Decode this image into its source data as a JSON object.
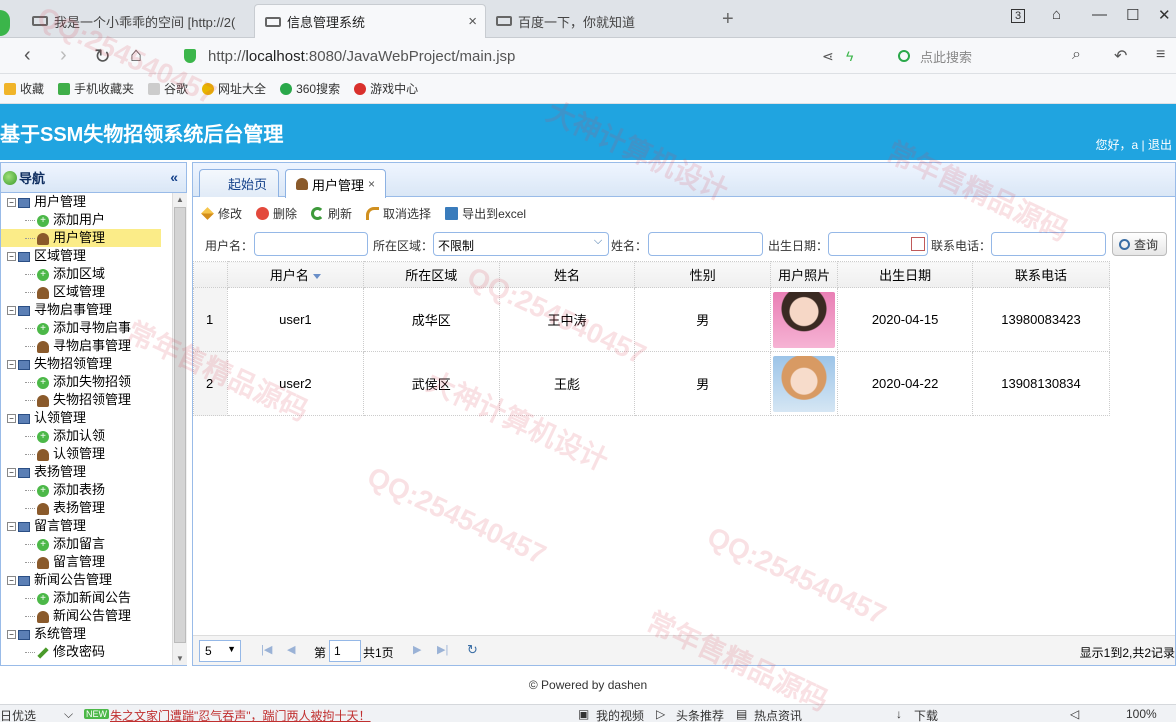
{
  "browser": {
    "tabs": [
      {
        "title": "我是一个小乖乖的空间 [http://2(",
        "active": false
      },
      {
        "title": "信息管理系统",
        "active": true
      },
      {
        "title": "百度一下，你就知道",
        "active": false
      }
    ],
    "tab_close": "×",
    "new_tab": "+",
    "tab_count": "3",
    "url_prefix": "http://",
    "url_host": "localhost",
    "url_path": ":8080/JavaWebProject/main.jsp",
    "search_placeholder": "点此搜索",
    "favorites": [
      {
        "label": "收藏",
        "color": "#f0b429"
      },
      {
        "label": "手机收藏夹",
        "color": "#3fae49"
      },
      {
        "label": "谷歌",
        "color": "#cccccc"
      },
      {
        "label": "网址大全",
        "color": "#e8b400"
      },
      {
        "label": "360搜索",
        "color": "#2aa84a"
      },
      {
        "label": "游戏中心",
        "color": "#d9302c"
      }
    ]
  },
  "app": {
    "title": "基于SSM失物招领系统后台管理",
    "user_greeting": "您好，a | 退出",
    "accent_color": "#20a4e0"
  },
  "nav": {
    "title": "导航",
    "collapse_icon": "«",
    "tree": [
      {
        "type": "parent",
        "label": "用户管理"
      },
      {
        "type": "child",
        "icon": "add",
        "label": "添加用户"
      },
      {
        "type": "child",
        "icon": "user",
        "label": "用户管理",
        "selected": true
      },
      {
        "type": "parent",
        "label": "区域管理"
      },
      {
        "type": "child",
        "icon": "add",
        "label": "添加区域"
      },
      {
        "type": "child",
        "icon": "user",
        "label": "区域管理"
      },
      {
        "type": "parent",
        "label": "寻物启事管理"
      },
      {
        "type": "child",
        "icon": "add",
        "label": "添加寻物启事"
      },
      {
        "type": "child",
        "icon": "user",
        "label": "寻物启事管理"
      },
      {
        "type": "parent",
        "label": "失物招领管理"
      },
      {
        "type": "child",
        "icon": "add",
        "label": "添加失物招领"
      },
      {
        "type": "child",
        "icon": "user",
        "label": "失物招领管理"
      },
      {
        "type": "parent",
        "label": "认领管理"
      },
      {
        "type": "child",
        "icon": "add",
        "label": "添加认领"
      },
      {
        "type": "child",
        "icon": "user",
        "label": "认领管理"
      },
      {
        "type": "parent",
        "label": "表扬管理"
      },
      {
        "type": "child",
        "icon": "add",
        "label": "添加表扬"
      },
      {
        "type": "child",
        "icon": "user",
        "label": "表扬管理"
      },
      {
        "type": "parent",
        "label": "留言管理"
      },
      {
        "type": "child",
        "icon": "add",
        "label": "添加留言"
      },
      {
        "type": "child",
        "icon": "user",
        "label": "留言管理"
      },
      {
        "type": "parent",
        "label": "新闻公告管理"
      },
      {
        "type": "child",
        "icon": "add",
        "label": "添加新闻公告"
      },
      {
        "type": "child",
        "icon": "user",
        "label": "新闻公告管理"
      },
      {
        "type": "parent",
        "label": "系统管理"
      },
      {
        "type": "child",
        "icon": "pen",
        "label": "修改密码"
      }
    ]
  },
  "main": {
    "tabs": [
      {
        "label": "起始页"
      },
      {
        "label": "用户管理",
        "close": "×"
      }
    ],
    "toolbar": {
      "edit": "修改",
      "delete": "删除",
      "refresh": "刷新",
      "cancel_select": "取消选择",
      "export": "导出到excel"
    },
    "search": {
      "username_label": "用户名：",
      "area_label": "所在区域：",
      "area_value": "不限制",
      "name_label": "姓名：",
      "birth_label": "出生日期：",
      "phone_label": "联系电话：",
      "query_button": "查询"
    },
    "grid": {
      "columns": [
        "用户名",
        "所在区域",
        "姓名",
        "性别",
        "用户照片",
        "出生日期",
        "联系电话"
      ],
      "rows": [
        {
          "rownum": "1",
          "username": "user1",
          "area": "成华区",
          "name": "王中涛",
          "gender": "男",
          "photo": "photo-girl-pink",
          "birth": "2020-04-15",
          "phone": "13980083423"
        },
        {
          "rownum": "2",
          "username": "user2",
          "area": "武侯区",
          "name": "王彪",
          "gender": "男",
          "photo": "photo-girl-blue",
          "birth": "2020-04-22",
          "phone": "13908130834"
        }
      ]
    },
    "pager": {
      "page_size": "5",
      "page_label_before": "第",
      "page_number": "1",
      "page_total": "共1页",
      "display_info": "显示1到2,共2记录"
    }
  },
  "footer": "© Powered by dashen",
  "statusbar": {
    "left": "日优选",
    "new_badge": "NEW",
    "news": "朱之文家门遭踹\"忍气吞声\"，踹门两人被拘十天！",
    "items": [
      "我的视频",
      "头条推荐",
      "热点资讯"
    ],
    "download": "下载",
    "zoom": "100%"
  },
  "watermarks": [
    "QQ:254540457",
    "大神计算机设计",
    "常年售精品源码"
  ]
}
